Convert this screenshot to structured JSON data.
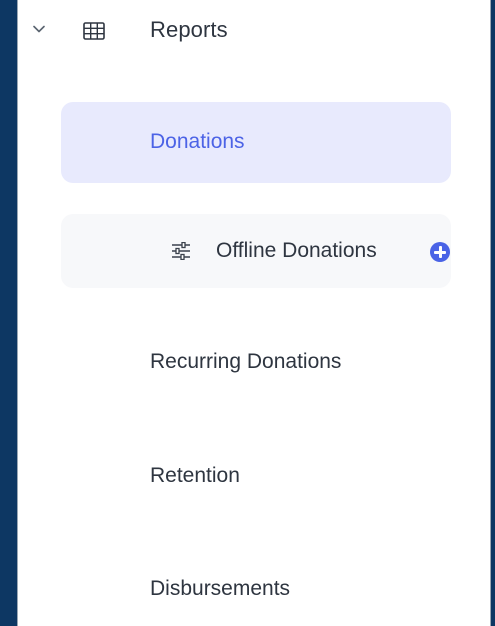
{
  "colors": {
    "background": "#0d3763",
    "panel": "#ffffff",
    "active_bg": "#e8eafd",
    "active_text": "#4c63e6",
    "hover_bg": "#f7f8fa",
    "text": "#2e3540",
    "accent": "#4a63e6"
  },
  "reports": {
    "label": "Reports",
    "expanded": true,
    "chevron_icon": "chevron-down-icon",
    "icon": "table-grid-icon"
  },
  "nav": {
    "donations": {
      "label": "Donations",
      "active": true
    },
    "offline": {
      "label": "Offline Donations",
      "icon": "sliders-icon",
      "action_icon": "add-circle-icon"
    },
    "recurring": {
      "label": "Recurring Donations"
    },
    "retention": {
      "label": "Retention"
    },
    "disbursements": {
      "label": "Disbursements"
    }
  }
}
